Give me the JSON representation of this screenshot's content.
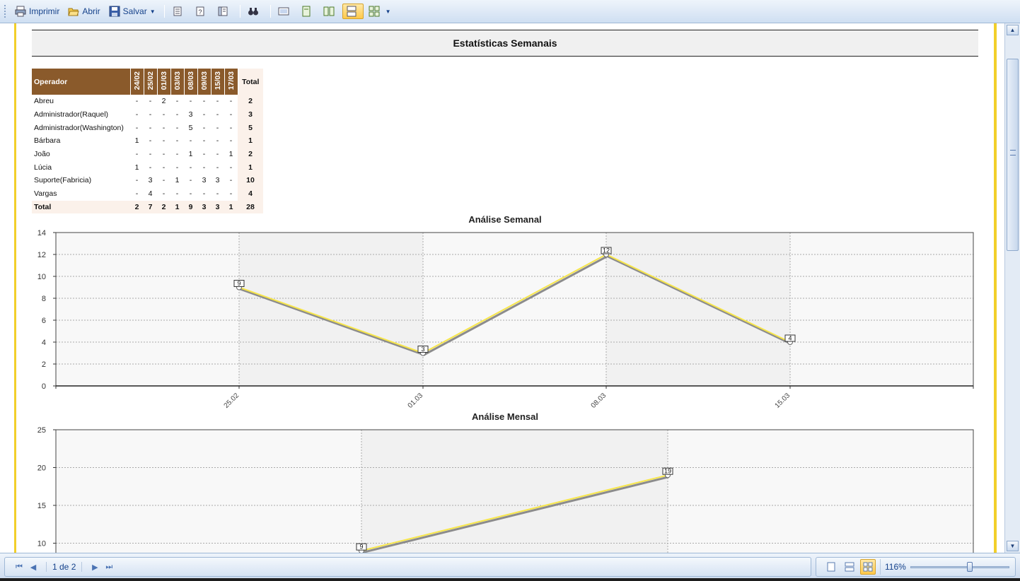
{
  "toolbar": {
    "print_label": "Imprimir",
    "open_label": "Abrir",
    "save_label": "Salvar"
  },
  "report": {
    "title": "Estatísticas Semanais",
    "table": {
      "header_operator": "Operador",
      "dates": [
        "24/02",
        "25/02",
        "01/03",
        "03/03",
        "08/03",
        "09/03",
        "15/03",
        "17/03"
      ],
      "header_total": "Total",
      "rows": [
        {
          "name": "Abreu",
          "values": [
            "-",
            "-",
            "2",
            "-",
            "-",
            "-",
            "-",
            "-"
          ],
          "total": "2"
        },
        {
          "name": "Administrador(Raquel)",
          "values": [
            "-",
            "-",
            "-",
            "-",
            "3",
            "-",
            "-",
            "-"
          ],
          "total": "3"
        },
        {
          "name": "Administrador(Washington)",
          "values": [
            "-",
            "-",
            "-",
            "-",
            "5",
            "-",
            "-",
            "-"
          ],
          "total": "5"
        },
        {
          "name": "Bárbara",
          "values": [
            "1",
            "-",
            "-",
            "-",
            "-",
            "-",
            "-",
            "-"
          ],
          "total": "1"
        },
        {
          "name": "João",
          "values": [
            "-",
            "-",
            "-",
            "-",
            "1",
            "-",
            "-",
            "1"
          ],
          "total": "2"
        },
        {
          "name": "Lúcia",
          "values": [
            "1",
            "-",
            "-",
            "-",
            "-",
            "-",
            "-",
            "-"
          ],
          "total": "1"
        },
        {
          "name": "Suporte(Fabricia)",
          "values": [
            "-",
            "3",
            "-",
            "1",
            "-",
            "3",
            "3",
            "-"
          ],
          "total": "10"
        },
        {
          "name": "Vargas",
          "values": [
            "-",
            "4",
            "-",
            "-",
            "-",
            "-",
            "-",
            "-"
          ],
          "total": "4"
        }
      ],
      "total_row": {
        "name": "Total",
        "values": [
          "2",
          "7",
          "2",
          "1",
          "9",
          "3",
          "3",
          "1"
        ],
        "total": "28"
      }
    }
  },
  "chart_data": [
    {
      "type": "line",
      "title": "Análise Semanal",
      "categories": [
        "25.02",
        "01.03",
        "08.03",
        "15.03"
      ],
      "values": [
        9,
        3,
        12,
        4
      ],
      "ylim": [
        0,
        14
      ],
      "yticks": [
        "0",
        "2",
        "4",
        "6",
        "8",
        "10",
        "12",
        "14"
      ],
      "grid": true,
      "line_color": "#f7e64a",
      "shadow_color": "#8c8c8c"
    },
    {
      "type": "line",
      "title": "Análise Mensal",
      "values": [
        9,
        19
      ],
      "yticks_visible": [
        "10",
        "15",
        "20",
        "25"
      ],
      "ylim": [
        5,
        25
      ],
      "grid": true,
      "line_color": "#f7e64a",
      "shadow_color": "#8c8c8c"
    }
  ],
  "statusbar": {
    "page_info": "1 de 2",
    "zoom": "116%",
    "zoom_fraction": 0.6
  }
}
